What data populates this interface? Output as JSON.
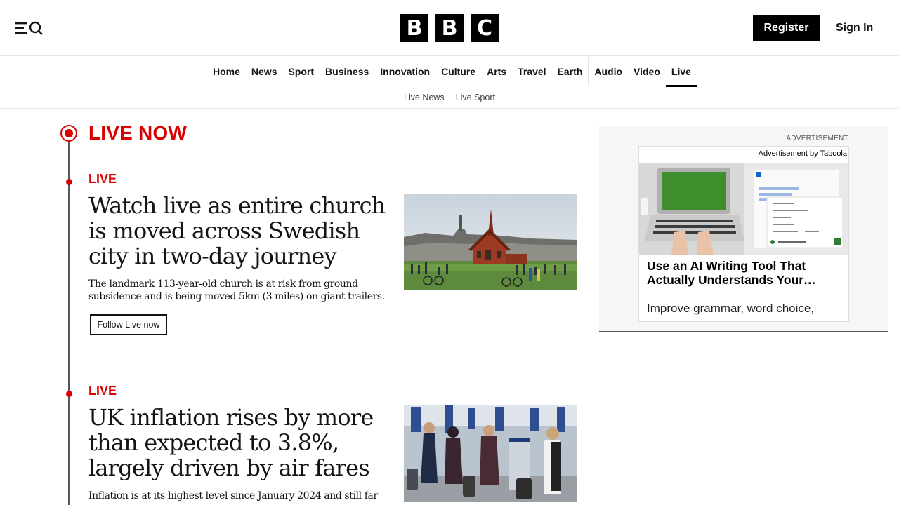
{
  "header": {
    "logo_letters": [
      "B",
      "B",
      "C"
    ],
    "register_label": "Register",
    "signin_label": "Sign In"
  },
  "nav": {
    "items": [
      "Home",
      "News",
      "Sport",
      "Business",
      "Innovation",
      "Culture",
      "Arts",
      "Travel",
      "Earth",
      "Audio",
      "Video",
      "Live"
    ],
    "active": "Live"
  },
  "subnav": {
    "items": [
      "Live News",
      "Live Sport"
    ]
  },
  "live": {
    "heading": "LIVE NOW",
    "accent_color": "#dd0000"
  },
  "stories": [
    {
      "label": "LIVE",
      "headline": "Watch live as entire church is moved across Swedish city in two-day journey",
      "summary": "The landmark 113-year-old church is at risk from ground subsidence and is being moved 5km (3 miles) on giant trailers.",
      "follow_label": "Follow Live now"
    },
    {
      "label": "LIVE",
      "headline": "UK inflation rises by more than expected to 3.8%, largely driven by air fares",
      "summary": "Inflation is at its highest level since January 2024 and still far"
    }
  ],
  "ad": {
    "label": "ADVERTISEMENT",
    "by": "Advertisement by Taboola",
    "title": "Use an AI Writing Tool That Actually Understands Your…",
    "desc": "Improve grammar, word choice,"
  }
}
